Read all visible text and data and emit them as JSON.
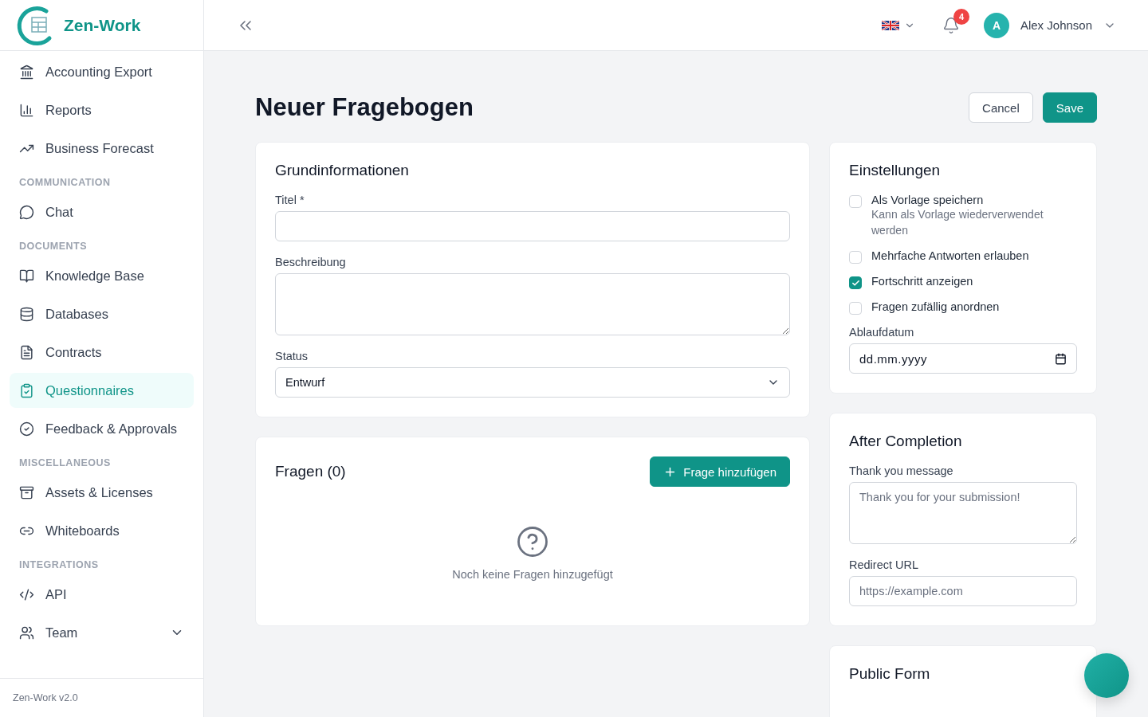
{
  "sidebar": {
    "brand": "Zen-Work",
    "items": [
      {
        "kind": "item",
        "label": "Accounting Export",
        "selected": false
      },
      {
        "kind": "item",
        "label": "Reports",
        "selected": false
      },
      {
        "kind": "item",
        "label": "Business Forecast",
        "selected": false
      },
      {
        "kind": "section",
        "label": "COMMUNICATION"
      },
      {
        "kind": "item",
        "label": "Chat",
        "selected": false
      },
      {
        "kind": "section",
        "label": "DOCUMENTS"
      },
      {
        "kind": "item",
        "label": "Knowledge Base",
        "selected": false
      },
      {
        "kind": "item",
        "label": "Databases",
        "selected": false
      },
      {
        "kind": "item",
        "label": "Contracts",
        "selected": false
      },
      {
        "kind": "item",
        "label": "Questionnaires",
        "selected": true
      },
      {
        "kind": "item",
        "label": "Feedback & Approvals",
        "selected": false
      },
      {
        "kind": "section",
        "label": "MISCELLANEOUS"
      },
      {
        "kind": "item",
        "label": "Assets & Licenses",
        "selected": false
      },
      {
        "kind": "item",
        "label": "Whiteboards",
        "selected": false
      },
      {
        "kind": "section",
        "label": "INTEGRATIONS"
      },
      {
        "kind": "item",
        "label": "API",
        "selected": false
      },
      {
        "kind": "item",
        "label": "Team",
        "selected": false,
        "expanded": false
      }
    ],
    "version": "Zen-Work v2.0"
  },
  "header": {
    "notifications": "4",
    "avatar": "A",
    "user": "Alex Johnson"
  },
  "page": {
    "title": "Neuer Fragebogen",
    "buttons": [
      {
        "kind": "secondary",
        "label": "Cancel"
      },
      {
        "kind": "primary",
        "label": "Save"
      }
    ]
  },
  "basic": {
    "title": "Grundinformationen",
    "fields": [
      {
        "kind": "input",
        "label": "Titel *"
      },
      {
        "kind": "textarea",
        "label": "Beschreibung"
      },
      {
        "kind": "select",
        "label": "Status",
        "value": "Entwurf"
      }
    ]
  },
  "questions": {
    "title": "Fragen (0)",
    "add": "Frage hinzufügen",
    "empty": "Noch keine Fragen hinzugefügt"
  },
  "settings": {
    "title": "Einstellungen",
    "options": [
      {
        "label": "Als Vorlage speichern",
        "hint": "Kann als Vorlage wiederverwendet werden",
        "checked": false
      },
      {
        "label": "Mehrfache Antworten erlauben",
        "checked": false
      },
      {
        "label": "Fortschritt anzeigen",
        "checked": true
      },
      {
        "label": "Fragen zufällig anordnen",
        "checked": false
      }
    ],
    "date": {
      "label": "Ablaufdatum",
      "placeholder": "dd.mm.yyyy"
    }
  },
  "completion": {
    "title": "After Completion",
    "fields": [
      {
        "kind": "textarea",
        "label": "Thank you message",
        "placeholder": "Thank you for your submission!"
      },
      {
        "kind": "input",
        "label": "Redirect URL",
        "placeholder": "https://example.com"
      }
    ]
  },
  "public": {
    "title": "Public Form"
  }
}
